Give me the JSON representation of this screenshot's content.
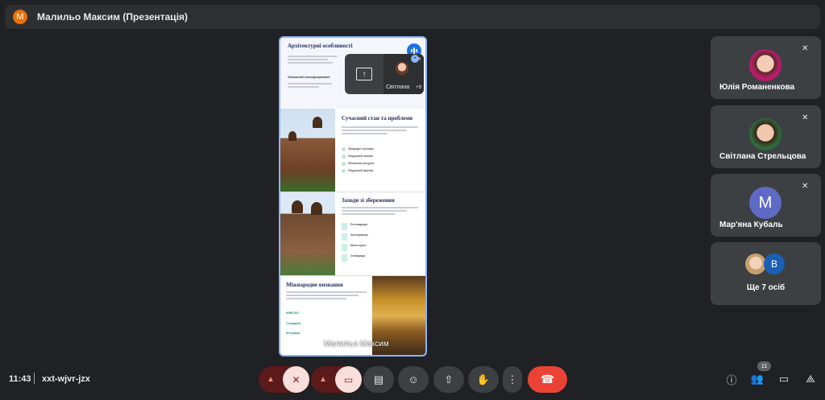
{
  "topbar": {
    "avatar_letter": "М",
    "title": "Малильо Максим (Презентація)"
  },
  "presentation": {
    "slide1": {
      "title": "Архітектурні особливості",
      "col1": "Унікальний стиль",
      "col2": "Декоративні"
    },
    "slide2": {
      "title": "Сучасний стан та проблеми",
      "items": [
        "Природні чинники",
        "Людський чинник",
        "Фінансові ресурси",
        "Людський фактор"
      ]
    },
    "slide3": {
      "title": "Заходи зі збереження",
      "items": [
        "Реставрація",
        "Консервація",
        "Моніторинг",
        "Співпраця"
      ]
    },
    "slide4": {
      "title": "Міжнародне визнання",
      "items": [
        "ЮНЕСКО",
        "Стандарти",
        "Інтеграція"
      ]
    },
    "presenter_label": "Малильо Максим",
    "overlay": {
      "name": "Світлана",
      "more": "+9"
    }
  },
  "participants": [
    {
      "name": "Юлія Романенкова"
    },
    {
      "name": "Світлана Стрельцова"
    },
    {
      "name": "Мар'яна Кубаль",
      "letter": "M"
    }
  ],
  "more_participants": {
    "letter": "В",
    "label": "Ще 7 осіб"
  },
  "bottombar": {
    "time": "11:43",
    "meeting_code": "xxt-wjvr-jzx",
    "people_count": "11"
  }
}
